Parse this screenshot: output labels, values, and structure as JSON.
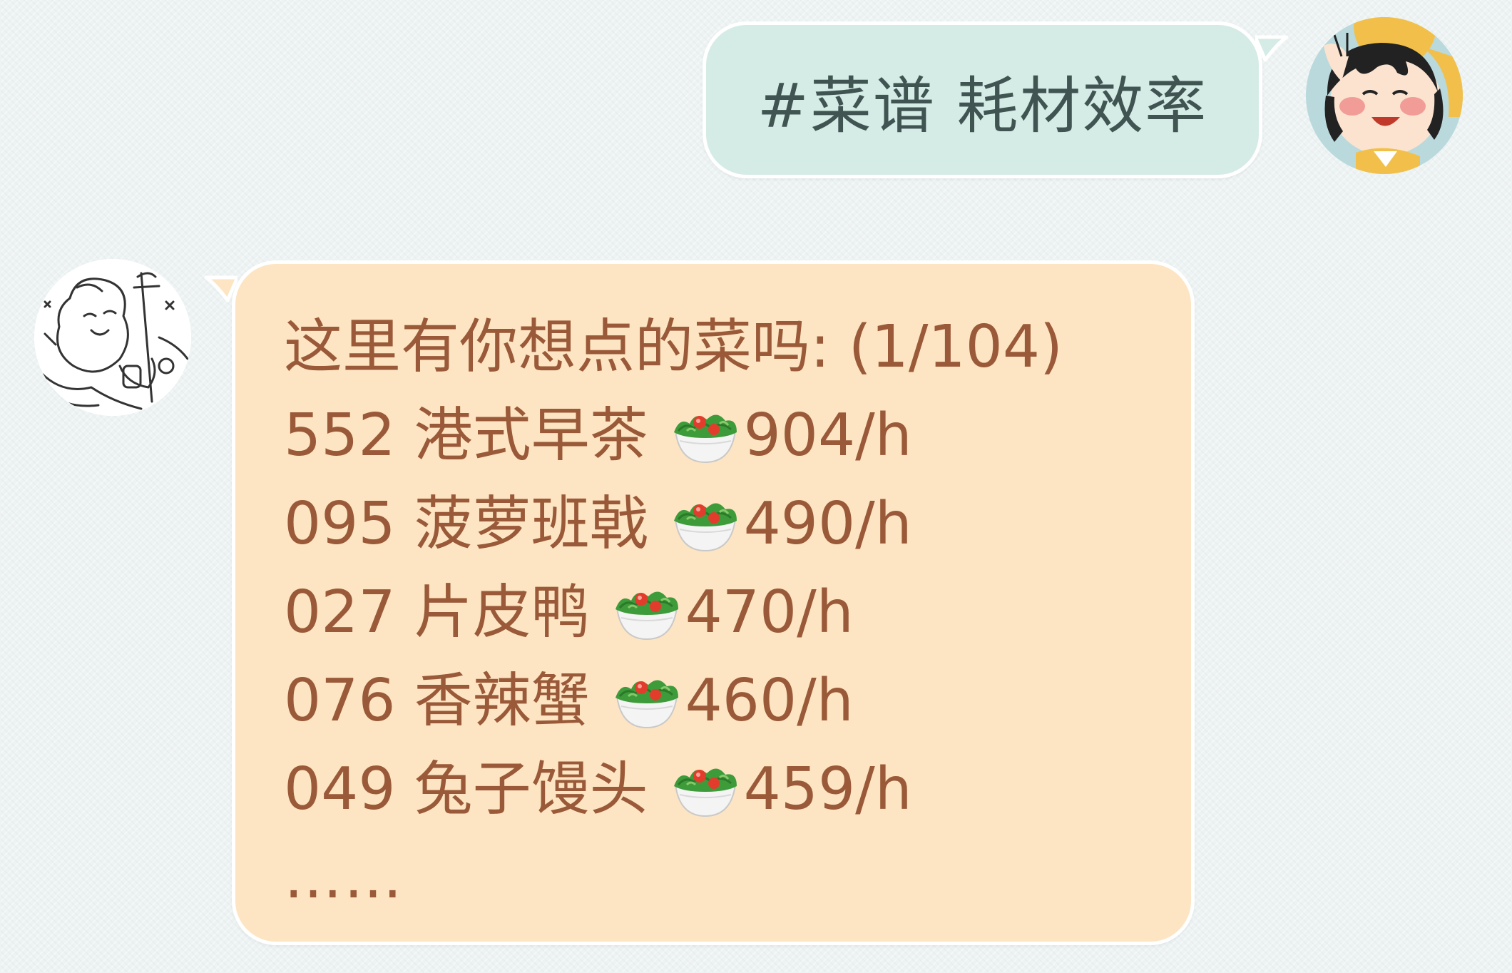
{
  "chat": {
    "outgoing": {
      "text": "#菜谱 耗材效率"
    },
    "incoming": {
      "header": "这里有你想点的菜吗: (1/104)",
      "items": [
        {
          "id": "552",
          "name": "港式早茶",
          "icon": "salad-icon",
          "rate": "904/h"
        },
        {
          "id": "095",
          "name": "菠萝班戟",
          "icon": "salad-icon",
          "rate": "490/h"
        },
        {
          "id": "027",
          "name": "片皮鸭",
          "icon": "salad-icon",
          "rate": "470/h"
        },
        {
          "id": "076",
          "name": "香辣蟹",
          "icon": "salad-icon",
          "rate": "460/h"
        },
        {
          "id": "049",
          "name": "兔子馒头",
          "icon": "salad-icon",
          "rate": "459/h"
        }
      ],
      "more": "……"
    }
  },
  "colors": {
    "background": "#edf3f3",
    "outgoing_bubble": "#d5ebe6",
    "outgoing_text": "#405552",
    "incoming_bubble": "#fde5c3",
    "incoming_text": "#9a5a39"
  }
}
